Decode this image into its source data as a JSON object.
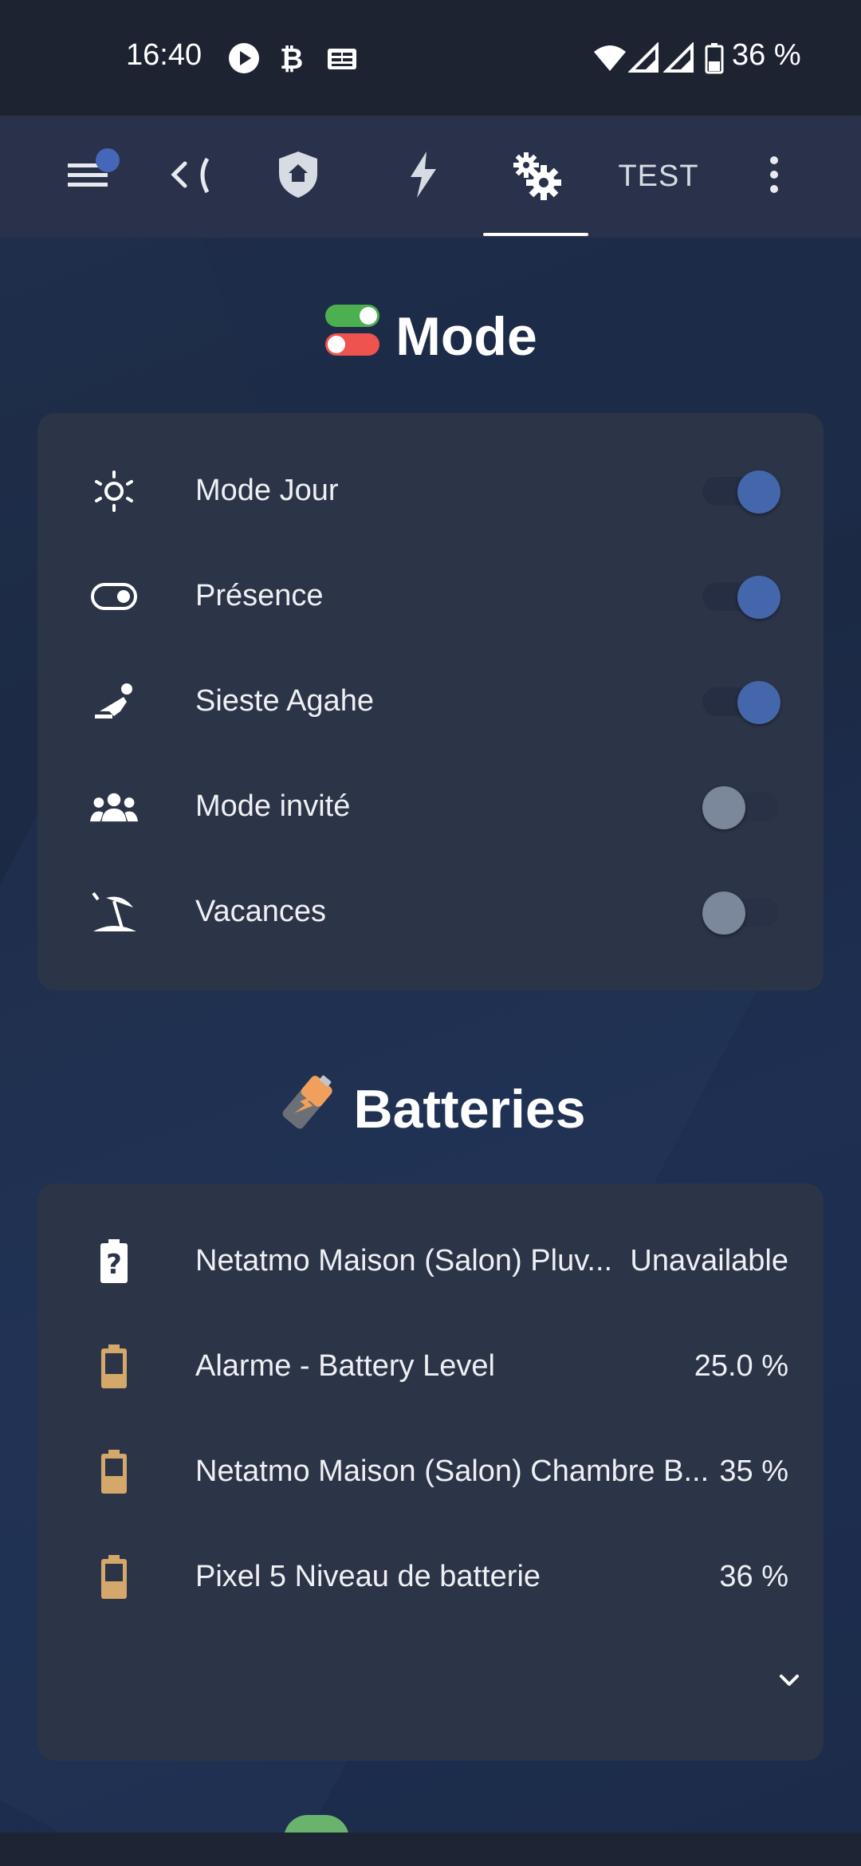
{
  "status_bar": {
    "time": "16:40",
    "battery_text": "36 %",
    "icons": [
      "play-icon",
      "bitcoin-icon",
      "news-icon",
      "wifi-icon",
      "signal-icon",
      "signal-icon",
      "battery-icon"
    ]
  },
  "toolbar": {
    "icons": [
      "menu-icon",
      "back-tab-icon",
      "shield-home-icon",
      "lightning-icon",
      "cogs-icon",
      "more-vert-icon"
    ],
    "tab_test_label": "TEST",
    "active_tab": "cogs"
  },
  "mode": {
    "title": "Mode",
    "rows": [
      {
        "label": "Mode Jour",
        "icon": "sun-icon",
        "state": "on"
      },
      {
        "label": "Présence",
        "icon": "toggle-switch-icon",
        "state": "on"
      },
      {
        "label": "Sieste Agahe",
        "icon": "sleep-icon",
        "state": "on"
      },
      {
        "label": "Mode invité",
        "icon": "group-icon",
        "state": "off"
      },
      {
        "label": "Vacances",
        "icon": "beach-icon",
        "state": "off"
      }
    ]
  },
  "batteries": {
    "title": "Batteries",
    "rows": [
      {
        "label": "Netatmo Maison (Salon) Pluv...",
        "value": "Unavailable",
        "icon": "battery-unknown-icon"
      },
      {
        "label": "Alarme - Battery Level",
        "value": "25.0 %",
        "icon": "battery-icon"
      },
      {
        "label": "Netatmo Maison (Salon) Chambre B...",
        "value": "35 %",
        "icon": "battery-icon"
      },
      {
        "label": "Pixel 5 Niveau de batterie",
        "value": "36 %",
        "icon": "battery-icon"
      }
    ]
  },
  "colors": {
    "accent": "#4466aa",
    "card": "#2c3448",
    "battery_icon": "#d4a86a"
  }
}
